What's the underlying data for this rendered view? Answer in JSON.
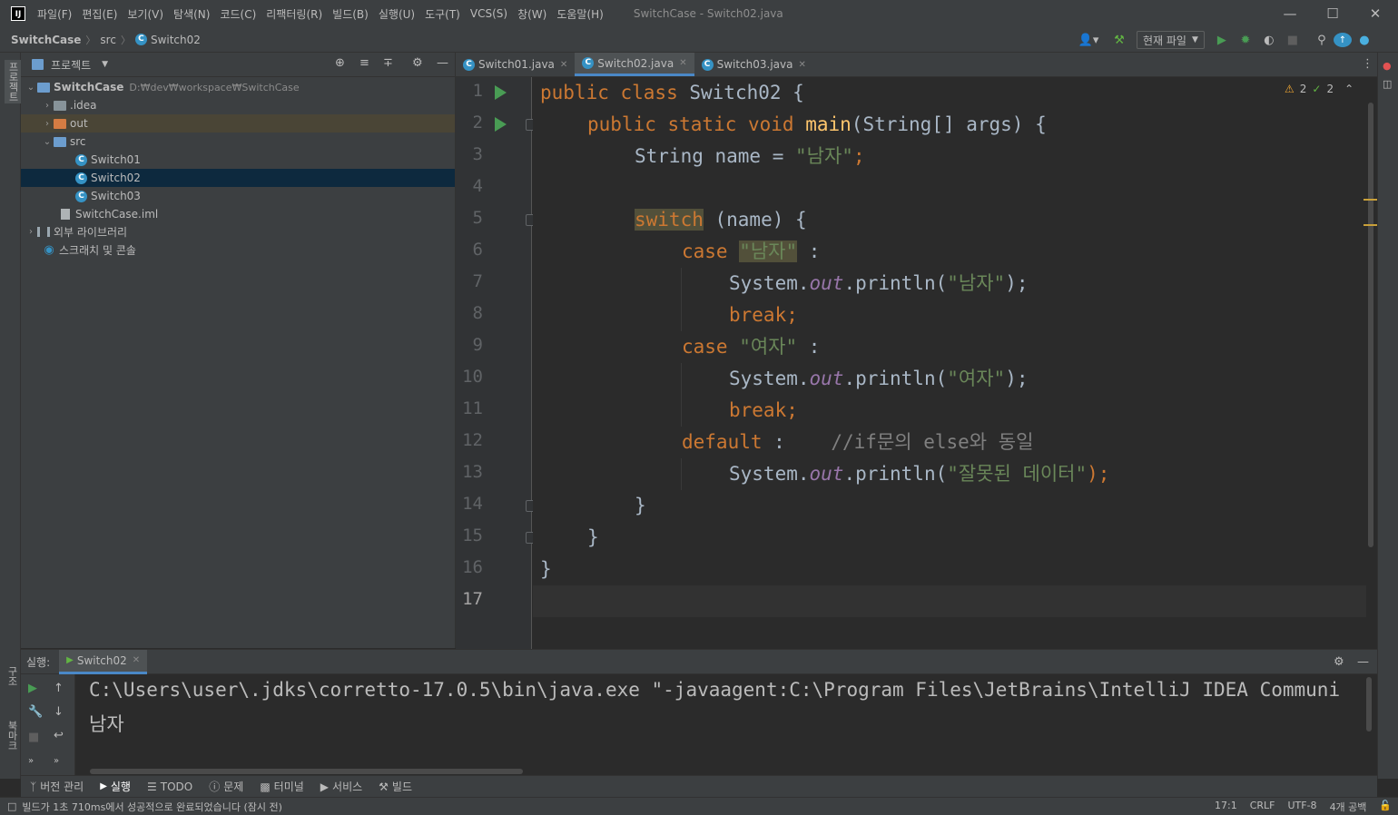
{
  "window": {
    "title": "SwitchCase - Switch02.java",
    "menu": [
      "파일(F)",
      "편집(E)",
      "보기(V)",
      "탐색(N)",
      "코드(C)",
      "리팩터링(R)",
      "빌드(B)",
      "실행(U)",
      "도구(T)",
      "VCS(S)",
      "창(W)",
      "도움말(H)"
    ]
  },
  "breadcrumb": [
    "SwitchCase",
    "src",
    "Switch02"
  ],
  "toolbar": {
    "run_config": "현재 파일"
  },
  "left_stripe": {
    "project_label": "프로젝트",
    "structure_label": "구조",
    "bookmarks_label": "북마크"
  },
  "project": {
    "title": "프로젝트",
    "tree": [
      {
        "label": "SwitchCase",
        "path": "D:₩dev₩workspace₩SwitchCase"
      },
      {
        "label": ".idea"
      },
      {
        "label": "out"
      },
      {
        "label": "src"
      },
      {
        "label": "Switch01"
      },
      {
        "label": "Switch02"
      },
      {
        "label": "Switch03"
      },
      {
        "label": "SwitchCase.iml"
      },
      {
        "label": "외부 라이브러리"
      },
      {
        "label": "스크래치 및 콘솔"
      }
    ]
  },
  "editor": {
    "tabs": [
      "Switch01.java",
      "Switch02.java",
      "Switch03.java"
    ],
    "active_tab": "Switch02.java",
    "warnings": "2",
    "weak_warnings": "2",
    "line_numbers": [
      "1",
      "2",
      "3",
      "4",
      "5",
      "6",
      "7",
      "8",
      "9",
      "10",
      "11",
      "12",
      "13",
      "14",
      "15",
      "16",
      "17"
    ],
    "code": {
      "l1_kw": "public class ",
      "l1_name": "Switch02 {",
      "l2_kw": "public static void ",
      "l2_fn": "main",
      "l2_rest": "(String[] args) {",
      "l3_a": "String name = ",
      "l3_str": "\"남자\"",
      "l3_semi": ";",
      "l5_kw": "switch",
      "l5_rest": " (name) {",
      "l6_kw": "case ",
      "l6_str": "\"남자\"",
      "l6_rest": " :",
      "l7_a": "System.",
      "l7_out": "out",
      "l7_b": ".println(",
      "l7_str": "\"남자\"",
      "l7_c": ");",
      "l8_kw": "break;",
      "l9_kw": "case ",
      "l9_str": "\"여자\"",
      "l9_rest": " :",
      "l10_a": "System.",
      "l10_out": "out",
      "l10_b": ".println(",
      "l10_str": "\"여자\"",
      "l10_c": ");",
      "l11_kw": "break;",
      "l12_kw": "default",
      "l12_rest": " :    ",
      "l12_cmt": "//if문의 else와 동일",
      "l13_a": "System.",
      "l13_out": "out",
      "l13_b": ".println(",
      "l13_str": "\"잘못된 데이터\"",
      "l13_c": ");",
      "l14": "}",
      "l15": "}",
      "l16": "}"
    }
  },
  "run": {
    "label": "실행:",
    "tab": "Switch02",
    "console": [
      "C:\\Users\\user\\.jdks\\corretto-17.0.5\\bin\\java.exe \"-javaagent:C:\\Program Files\\JetBrains\\IntelliJ IDEA Communi",
      "남자"
    ]
  },
  "bottom_tabs": [
    "버전 관리",
    "실행",
    "TODO",
    "문제",
    "터미널",
    "서비스",
    "빌드"
  ],
  "status": {
    "message": "빌드가 1초 710ms에서 성공적으로 완료되었습니다 (잠시 전)",
    "position": "17:1",
    "line_sep": "CRLF",
    "encoding": "UTF-8",
    "indent": "4개 공백"
  },
  "colors": {
    "keyword": "#cc7832",
    "string": "#6a8759",
    "function": "#ffc66d",
    "field": "#9876aa",
    "comment": "#808080",
    "selection": "#0d293e",
    "accent": "#4a88c7"
  }
}
